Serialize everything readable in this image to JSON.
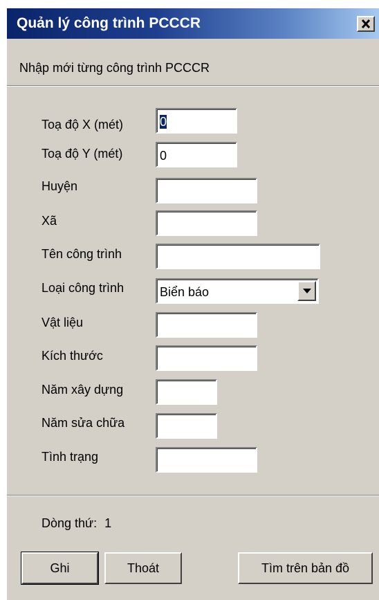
{
  "window": {
    "title": "Quản lý công trình PCCCR",
    "close_icon": "close-icon"
  },
  "subtitle": "Nhập mới từng công trình PCCCR",
  "form": {
    "x": {
      "label": "Toạ độ X (mét)",
      "value": "0"
    },
    "y": {
      "label": "Toạ độ Y (mét)",
      "value": "0"
    },
    "huyen": {
      "label": "Huyện",
      "value": ""
    },
    "xa": {
      "label": "Xã",
      "value": ""
    },
    "ten_cong_trinh": {
      "label": "Tên công trình",
      "value": ""
    },
    "loai_cong_trinh": {
      "label": "Loại công trình",
      "value": "Biển báo",
      "arrow_icon": "chevron-down-icon"
    },
    "vat_lieu": {
      "label": "Vật liệu",
      "value": ""
    },
    "kich_thuoc": {
      "label": "Kích thước",
      "value": ""
    },
    "nam_xay_dung": {
      "label": "Năm xây dựng",
      "value": ""
    },
    "nam_sua_chua": {
      "label": "Năm sửa chữa",
      "value": ""
    },
    "tinh_trang": {
      "label": "Tình trạng",
      "value": ""
    }
  },
  "status": {
    "row_label": "Dòng thứ:",
    "row_value": "1"
  },
  "buttons": {
    "save": "Ghi",
    "exit": "Thoát",
    "find_on_map": "Tìm trên bản đồ"
  },
  "colors": {
    "titlebar_start": "#0a246a",
    "titlebar_end": "#a6caf0",
    "window_face": "#d4d0c8",
    "selection": "#0a246a"
  }
}
